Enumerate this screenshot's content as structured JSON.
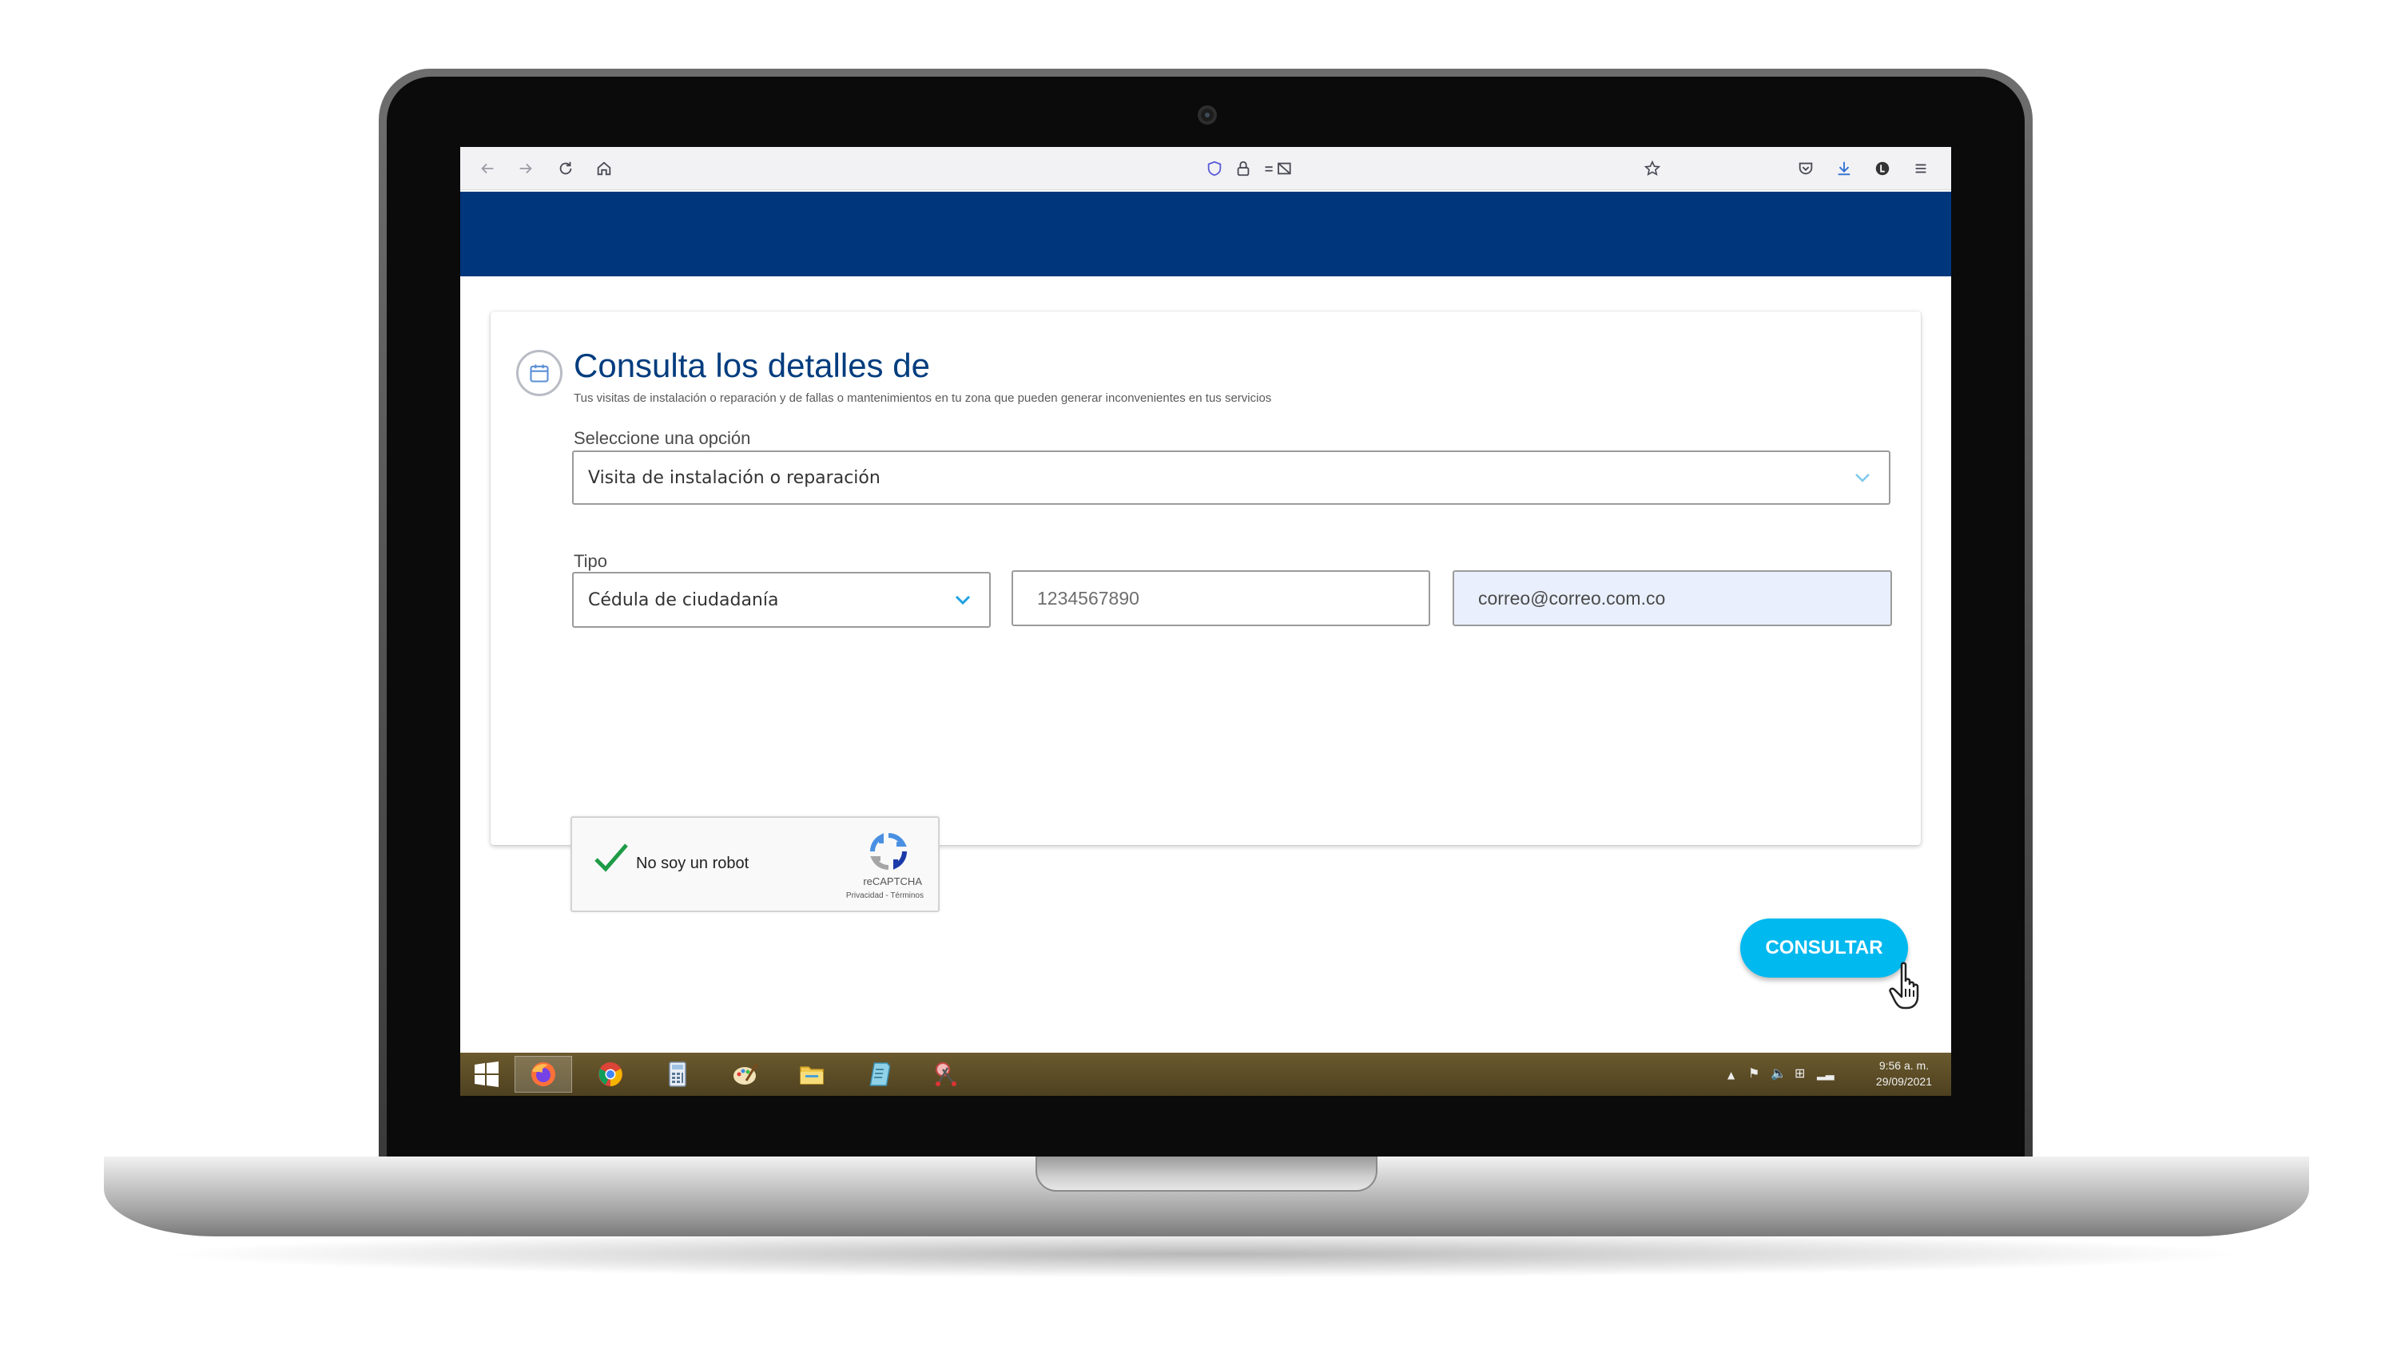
{
  "page": {
    "title": "Consulta los detalles de",
    "subtitle": "Tus visitas de instalación o reparación y de fallas o mantenimientos en tu zona que pueden generar inconvenientes en tus servicios"
  },
  "form": {
    "option_label": "Seleccione una opción",
    "option_value": "Visita de instalación o reparación",
    "tipo_label": "Tipo",
    "tipo_value": "Cédula de ciudadanía",
    "document_value": "1234567890",
    "email_value": "correo@correo.com.co",
    "submit_label": "CONSULTAR"
  },
  "recaptcha": {
    "label": "No soy un robot",
    "brand": "reCAPTCHA",
    "terms": "Privacidad - Términos"
  },
  "taskbar": {
    "time": "9:56 a. m.",
    "date": "29/09/2021"
  },
  "colors": {
    "header_blue": "#00377c",
    "title_blue": "#003c7e",
    "button_cyan": "#00b9ef",
    "email_fill": "#e9effc"
  },
  "icons": {
    "card": "calendar-icon",
    "browser": [
      "back-arrow-icon",
      "forward-arrow-icon",
      "reload-icon",
      "home-icon",
      "shield-icon",
      "lock-icon",
      "permissions-icon",
      "bookmark-star-icon",
      "pocket-icon",
      "download-icon",
      "account-icon",
      "menu-icon"
    ],
    "taskbar": [
      "windows-start-icon",
      "firefox-icon",
      "chrome-icon",
      "calculator-icon",
      "paint-icon",
      "file-explorer-icon",
      "notepad-icon",
      "snipping-tool-icon"
    ]
  }
}
